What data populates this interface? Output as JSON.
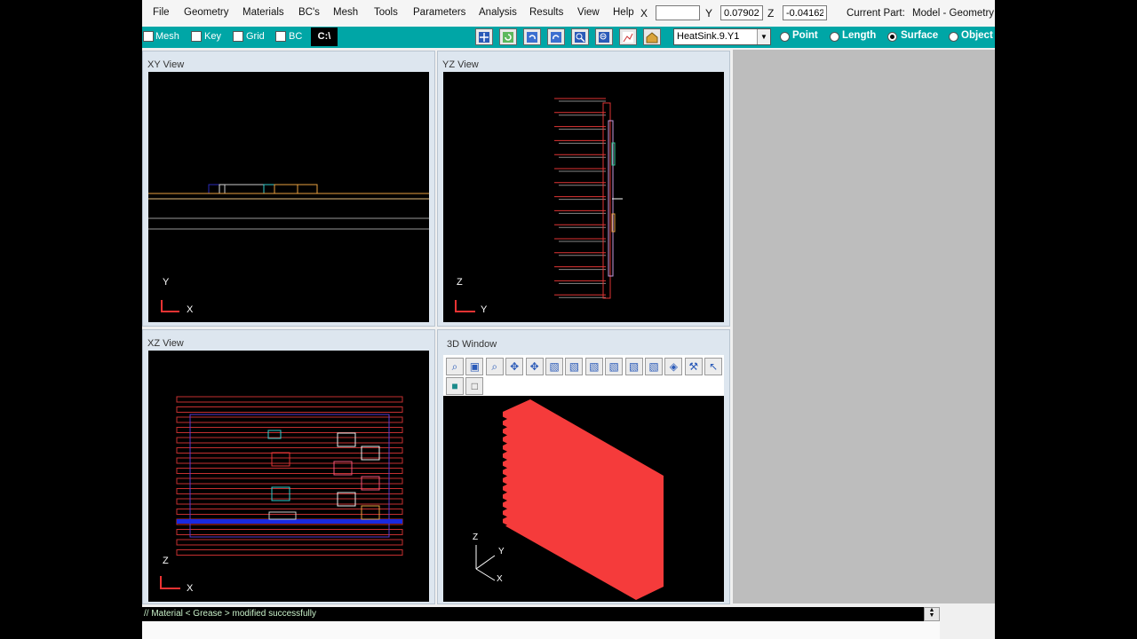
{
  "menu": [
    "File",
    "Geometry",
    "Materials",
    "BC's",
    "Mesh",
    "Tools",
    "Parameters",
    "Analysis",
    "Results",
    "View",
    "Help"
  ],
  "coords": {
    "x_label": "X",
    "x_value": "",
    "y_label": "Y",
    "y_value": "0.07902",
    "z_label": "Z",
    "z_value": "-0.04162"
  },
  "current_part": {
    "label": "Current Part:",
    "value": "Model - Geometry"
  },
  "toolbar": {
    "checkboxes": [
      "Mesh",
      "Key",
      "Grid",
      "BC"
    ],
    "command_button": "C:\\",
    "tool_icons": [
      "fit-view-icon",
      "refresh-icon",
      "undo-icon",
      "redo-icon",
      "zoom-in-icon",
      "zoom-out-icon",
      "chart-icon",
      "home-icon"
    ],
    "part_select": "HeatSink.9.Y1",
    "select_modes": [
      "Point",
      "Length",
      "Surface",
      "Object"
    ],
    "selected_mode": "Surface"
  },
  "views": {
    "xy": {
      "title": "XY View",
      "axis_v": "Y",
      "axis_h": "X"
    },
    "yz": {
      "title": "YZ View",
      "axis_v": "Z",
      "axis_h": "Y"
    },
    "xz": {
      "title": "XZ View",
      "axis_v": "Z",
      "axis_h": "X"
    },
    "w3d": {
      "title": "3D Window",
      "axis_z": "Z",
      "axis_y": "Y",
      "axis_x": "X"
    }
  },
  "view3d_tools": [
    "pan-icon",
    "zoom-window-icon",
    "zoom-icon",
    "rotate-icon",
    "move-icon",
    "front-view-icon",
    "back-view-icon",
    "top-view-icon",
    "bottom-view-icon",
    "left-view-icon",
    "right-view-icon",
    "iso-view-icon",
    "tools-icon",
    "pointer-icon"
  ],
  "view3d_tools_row2": [
    "solid-render-icon",
    "wireframe-render-icon"
  ],
  "colors": {
    "heatsink": "#f53b3b",
    "toolbar": "#00a6a6",
    "panel": "#dde6ef"
  },
  "console": {
    "message": "// Material < Grease > modified successfully"
  }
}
